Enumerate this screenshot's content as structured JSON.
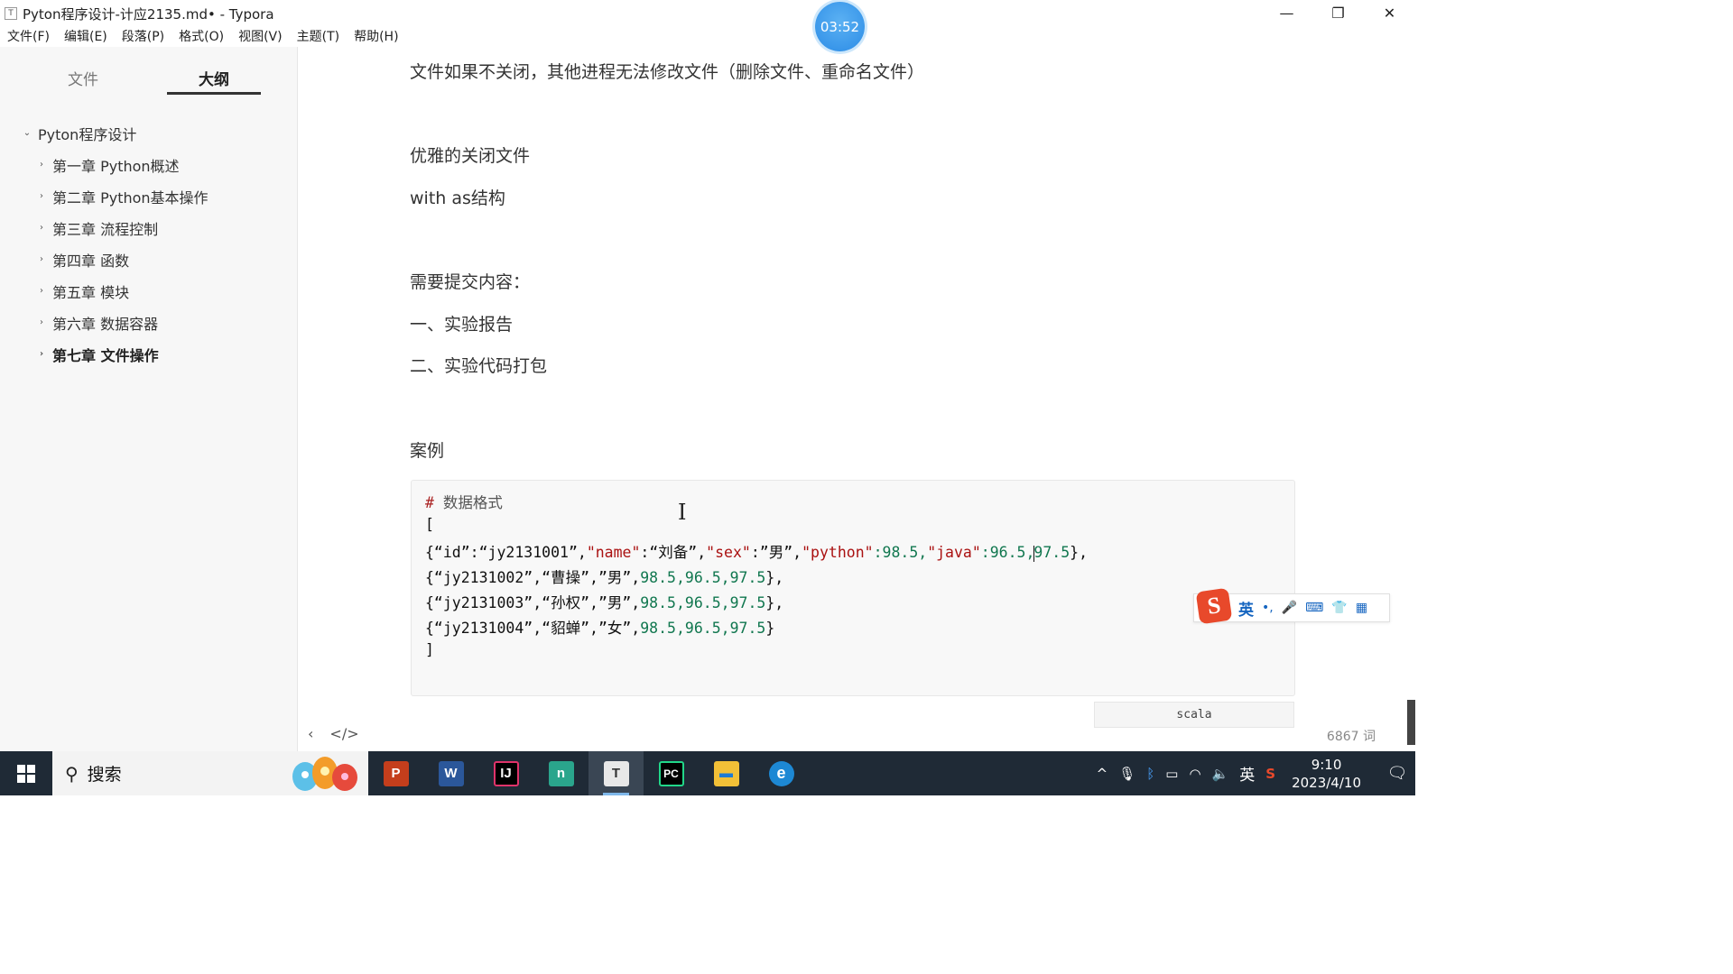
{
  "window": {
    "title": "Pyton程序设计-计应2135.md• - Typora",
    "app_icon": "T",
    "controls": {
      "minimize": "—",
      "restore": "❐",
      "close": "✕"
    }
  },
  "timer": "03:52",
  "menu": [
    "文件(F)",
    "编辑(E)",
    "段落(P)",
    "格式(O)",
    "视图(V)",
    "主题(T)",
    "帮助(H)"
  ],
  "sidebar": {
    "tab_files": "文件",
    "tab_outline": "大纲",
    "root": "Pyton程序设计",
    "items": [
      "第一章 Python概述",
      "第二章 Python基本操作",
      "第三章 流程控制",
      "第四章 函数",
      "第五章 模块",
      "第六章 数据容器",
      "第七章 文件操作"
    ],
    "active_index": 6
  },
  "document": {
    "paragraphs": [
      "文件如果不关闭，其他进程无法修改文件（删除文件、重命名文件）",
      "优雅的关闭文件",
      "with as结构",
      "需要提交内容：",
      "一、实验报告",
      "二、实验代码打包",
      "案例"
    ],
    "code": {
      "comment_mark": "#",
      "comment_text": " 数据格式",
      "open_bracket": "[",
      "row1": {
        "open": "{“id”:“jy2131001”,",
        "k_name": "\"name\"",
        "v_name": ":“刘备”,",
        "k_sex": "\"sex\"",
        "v_sex": ":”男”,",
        "k_python": "\"python\"",
        "n_python": ":98.5,",
        "k_java": "\"java\"",
        "n_java": ":96.5,",
        "n_last": "97.5",
        "close": "},"
      },
      "row2": {
        "text": "{“jy2131002”,“曹操”,”男”,",
        "nums": "98.5,96.5,97.5",
        "close": "},"
      },
      "row3": {
        "text": "{“jy2131003”,“孙权”,”男”,",
        "nums": "98.5,96.5,97.5",
        "close": "},"
      },
      "row4": {
        "text": "{“jy2131004”,“貂蝉”,”女”,",
        "nums": "98.5,96.5,97.5",
        "close": "}"
      },
      "close_bracket": "]",
      "language": "scala"
    }
  },
  "ime": {
    "logo": "S",
    "mode": "英",
    "punct": "•,",
    "mic": "🎤",
    "keyboard": "⌨",
    "skin": "👕",
    "tools": "▦"
  },
  "footer": {
    "back": "‹",
    "source": "</>",
    "word_count": "6867 词"
  },
  "taskbar": {
    "search_placeholder": "搜索",
    "apps": [
      {
        "name": "powerpoint",
        "glyph": "P",
        "color": "#c43e1c"
      },
      {
        "name": "word",
        "glyph": "W",
        "color": "#2b579a"
      },
      {
        "name": "intellij",
        "glyph": "IJ",
        "color": "#000000"
      },
      {
        "name": "notepad-app",
        "glyph": "n",
        "color": "#2aa58c"
      },
      {
        "name": "typora",
        "glyph": "T",
        "color": "#e8e8e8"
      },
      {
        "name": "pycharm",
        "glyph": "PC",
        "color": "#000000"
      },
      {
        "name": "file-explorer",
        "glyph": "▬",
        "color": "#f2c037"
      },
      {
        "name": "edge",
        "glyph": "e",
        "color": "#1d88d4"
      }
    ],
    "active_app_index": 4,
    "tray": {
      "chevron": "^",
      "mic": "🎙",
      "bluetooth": "ᛒ",
      "battery": "▭",
      "wifi": "◠",
      "volume": "🔈",
      "ime": "英",
      "sogou": "S"
    },
    "time": "9:10",
    "date": "2023/4/10",
    "notifications": "🗨"
  }
}
